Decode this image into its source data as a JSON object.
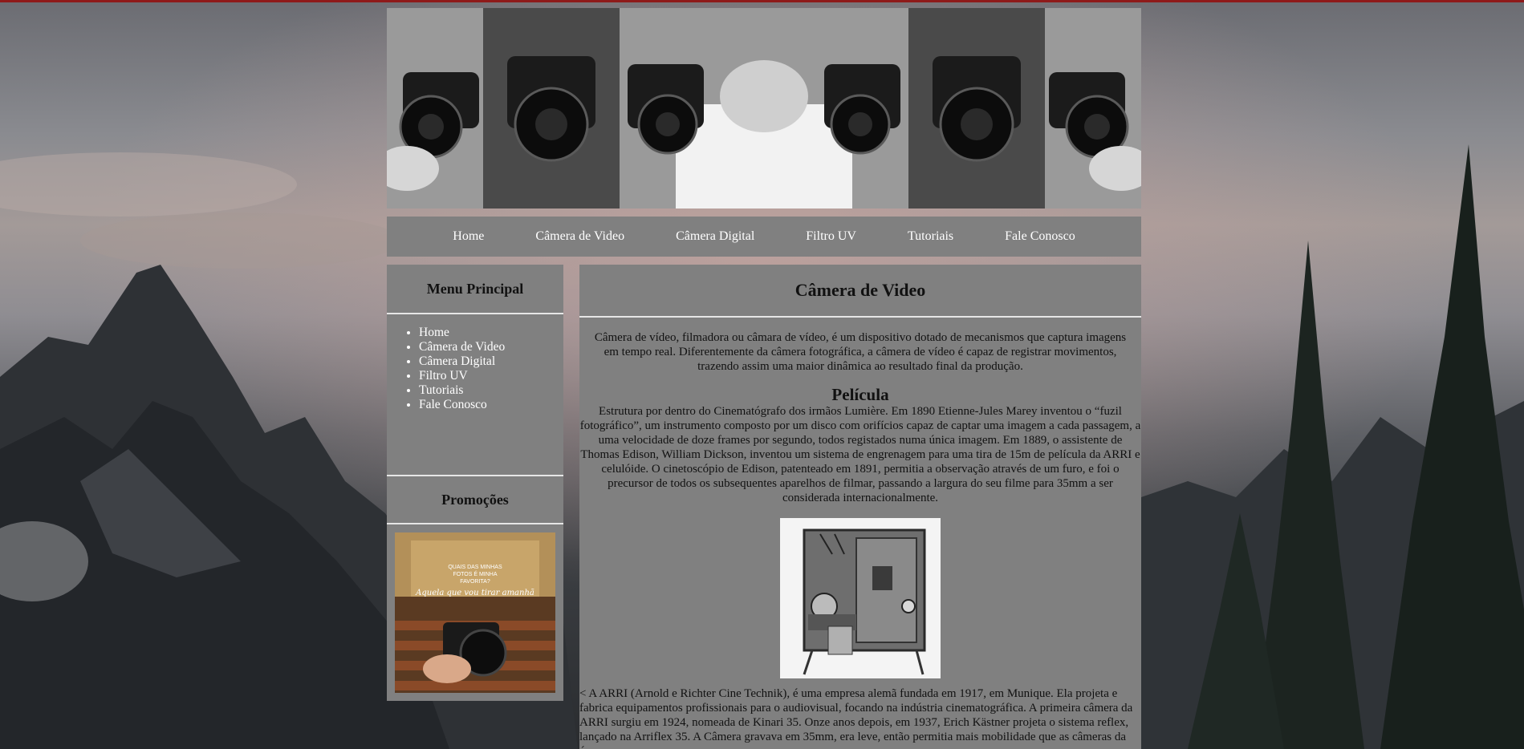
{
  "nav": {
    "items": [
      "Home",
      "Câmera de Video",
      "Câmera Digital",
      "Filtro UV",
      "Tutoriais",
      "Fale Conosco"
    ]
  },
  "sidebar": {
    "menu_title": "Menu Principal",
    "menu_items": [
      "Home",
      "Câmera de Video",
      "Câmera Digital",
      "Filtro UV",
      "Tutoriais",
      "Fale Conosco"
    ],
    "promo_title": "Promoções",
    "promo_image_text": [
      "QUAIS DAS MINHAS",
      "FOTOS É MINHA",
      "FAVORITA?",
      "Aquela que vou tirar amanhã"
    ]
  },
  "content": {
    "title": "Câmera de Video",
    "intro": "Câmera de vídeo, filmadora ou câmara de vídeo, é um dispositivo dotado de mecanismos que captura imagens em tempo real. Diferentemente da câmera fotográfica, a câmera de vídeo é capaz de registrar movimentos, trazendo assim uma maior dinâmica ao resultado final da produção.",
    "section_title": "Película",
    "paragraph1": "Estrutura por dentro do Cinematógrafo dos irmãos Lumière. Em 1890 Etienne-Jules Marey inventou o “fuzil fotográfico”, um instrumento composto por um disco com orifícios capaz de captar uma imagem a cada passagem, a uma velocidade de doze frames por segundo, todos registados numa única imagem. Em 1889, o assistente de Thomas Edison, William Dickson, inventou um sistema de engrenagem para uma tira de 15m de película da ARRI e celulóide. O cinetoscópio de Edison, patenteado em 1891, permitia a observação através de um furo, e foi o precursor de todos os subsequentes aparelhos de filmar, passando a largura do seu filme para 35mm a ser considerada internacionalmente.",
    "paragraph2": "< A ARRI (Arnold e Richter Cine Technik), é uma empresa alemã fundada em 1917, em Munique. Ela projeta e fabrica equipamentos profissionais para o audiovisual, focando na indústria cinematográfica. A primeira câmera da ARRI surgiu em 1924, nomeada de Kinari 35. Onze anos depois, em 1937, Erich Kästner projeta o sistema reflex, lançado na Arriflex 35. A Câmera gravava em 35mm, era leve, então permitia mais mobilidade que as câmeras da época."
  },
  "colors": {
    "panel": "#808080",
    "divider": "#e6e6e6",
    "top_line": "#8e1a1a"
  }
}
